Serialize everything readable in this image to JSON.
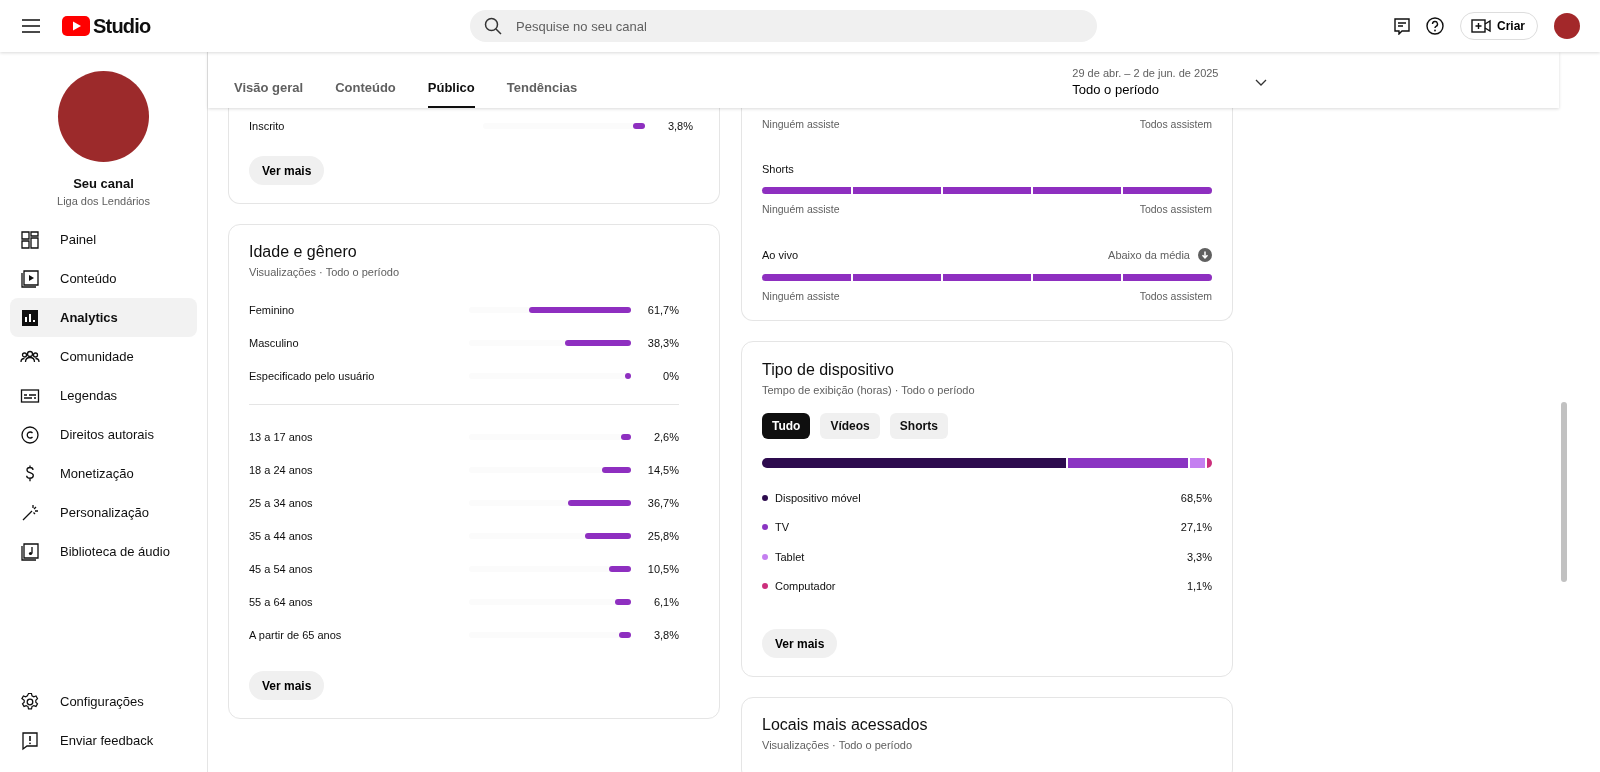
{
  "header": {
    "logo_text": "Studio",
    "search": {
      "placeholder": "Pesquise no seu canal"
    },
    "create_button": "Criar"
  },
  "sidebar": {
    "channel": {
      "name": "Seu canal",
      "handle": "Liga dos Lendários"
    },
    "items": [
      {
        "label": "Painel",
        "selected": false
      },
      {
        "label": "Conteúdo",
        "selected": false
      },
      {
        "label": "Analytics",
        "selected": true
      },
      {
        "label": "Comunidade",
        "selected": false
      },
      {
        "label": "Legendas",
        "selected": false
      },
      {
        "label": "Direitos autorais",
        "selected": false
      },
      {
        "label": "Monetização",
        "selected": false
      },
      {
        "label": "Personalização",
        "selected": false
      },
      {
        "label": "Biblioteca de áudio",
        "selected": false
      }
    ],
    "footer_items": [
      {
        "label": "Configurações"
      },
      {
        "label": "Enviar feedback"
      }
    ]
  },
  "tabs": [
    {
      "label": "Visão geral",
      "selected": false
    },
    {
      "label": "Conteúdo",
      "selected": false
    },
    {
      "label": "Público",
      "selected": true
    },
    {
      "label": "Tendências",
      "selected": false
    }
  ],
  "date_range": {
    "range": "29 de abr. – 2 de jun. de 2025",
    "period": "Todo o período"
  },
  "subscription": {
    "rows": [
      {
        "label": "Inscrito",
        "value": "3,8%",
        "level": 0.038
      }
    ],
    "button": "Ver mais"
  },
  "age_gender": {
    "title": "Idade e gênero",
    "subtitle": "Visualizações · Todo o período",
    "gender": [
      {
        "label": "Feminino",
        "value": "61,7%",
        "level": 0.617
      },
      {
        "label": "Masculino",
        "value": "38,3%",
        "level": 0.383
      },
      {
        "label": "Especificado pelo usuário",
        "value": "0%",
        "level": 0
      }
    ],
    "ages": [
      {
        "label": "13 a 17 anos",
        "value": "2,6%",
        "level": 0.026
      },
      {
        "label": "18 a 24 anos",
        "value": "14,5%",
        "level": 0.145
      },
      {
        "label": "25 a 34 anos",
        "value": "36,7%",
        "level": 0.367
      },
      {
        "label": "35 a 44 anos",
        "value": "25,8%",
        "level": 0.258
      },
      {
        "label": "45 a 54 anos",
        "value": "10,5%",
        "level": 0.105
      },
      {
        "label": "55 a 64 anos",
        "value": "6,1%",
        "level": 0.061
      },
      {
        "label": "A partir de 65 anos",
        "value": "3,8%",
        "level": 0.038
      }
    ],
    "button": "Ver mais"
  },
  "watch_pattern": {
    "top_scale": {
      "min_label": "Ninguém assiste",
      "max_label": "Todos assistem"
    },
    "formats": [
      {
        "name": "Shorts",
        "level": 1,
        "min_label": "Ninguém assiste",
        "max_label": "Todos assistem"
      },
      {
        "name": "Ao vivo",
        "badge": "Abaixo da média",
        "level": 1,
        "min_label": "Ninguém assiste",
        "max_label": "Todos assistem"
      }
    ]
  },
  "device_type": {
    "title": "Tipo de dispositivo",
    "subtitle": "Tempo de exibição (horas) · Todo o período",
    "filters": [
      {
        "label": "Tudo",
        "selected": true
      },
      {
        "label": "Vídeos",
        "selected": false
      },
      {
        "label": "Shorts",
        "selected": false
      }
    ],
    "devices": [
      {
        "name": "Dispositivo móvel",
        "value": "68,5%",
        "color": "#2d0b4e"
      },
      {
        "name": "TV",
        "value": "27,1%",
        "color": "#8a34c2"
      },
      {
        "name": "Tablet",
        "value": "3,3%",
        "color": "#c47ff0"
      },
      {
        "name": "Computador",
        "value": "1,1%",
        "color": "#cc2f7c"
      }
    ],
    "button": "Ver mais"
  },
  "top_locations": {
    "title": "Locais mais acessados",
    "subtitle": "Visualizações · Todo o período"
  }
}
